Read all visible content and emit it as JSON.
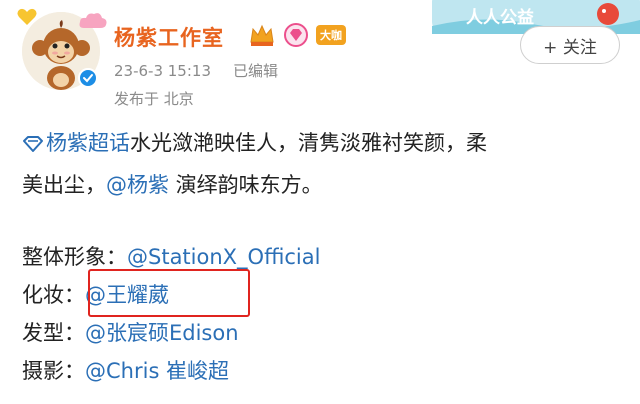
{
  "header": {
    "username": "杨紫工作室",
    "badge_big": "大咖",
    "time": "23-6-3 15:13",
    "edited": "已编辑",
    "location": "发布于 北京",
    "follow": "+ 关注",
    "banner_text": "人人公益"
  },
  "post": {
    "topic": "杨紫超话",
    "line1_rest": "水光潋滟映佳人，清隽淡雅衬笑颜，柔",
    "line2_pre": "美出尘，",
    "line2_mention": "@杨紫",
    "line2_post": " 演绎韵味东方。",
    "credits": [
      {
        "label": "整体形象：",
        "mention": "@StationX_Official"
      },
      {
        "label": "化妆：",
        "mention": "@王耀葳"
      },
      {
        "label": "发型：",
        "mention": "@张宸硕Edison"
      },
      {
        "label": "摄影：",
        "mention": "@Chris 崔峻超"
      }
    ]
  },
  "colors": {
    "username": "#e8641f",
    "link": "#2b6fb6",
    "meta": "#8a8a8a",
    "highlight": "#e0241f"
  }
}
